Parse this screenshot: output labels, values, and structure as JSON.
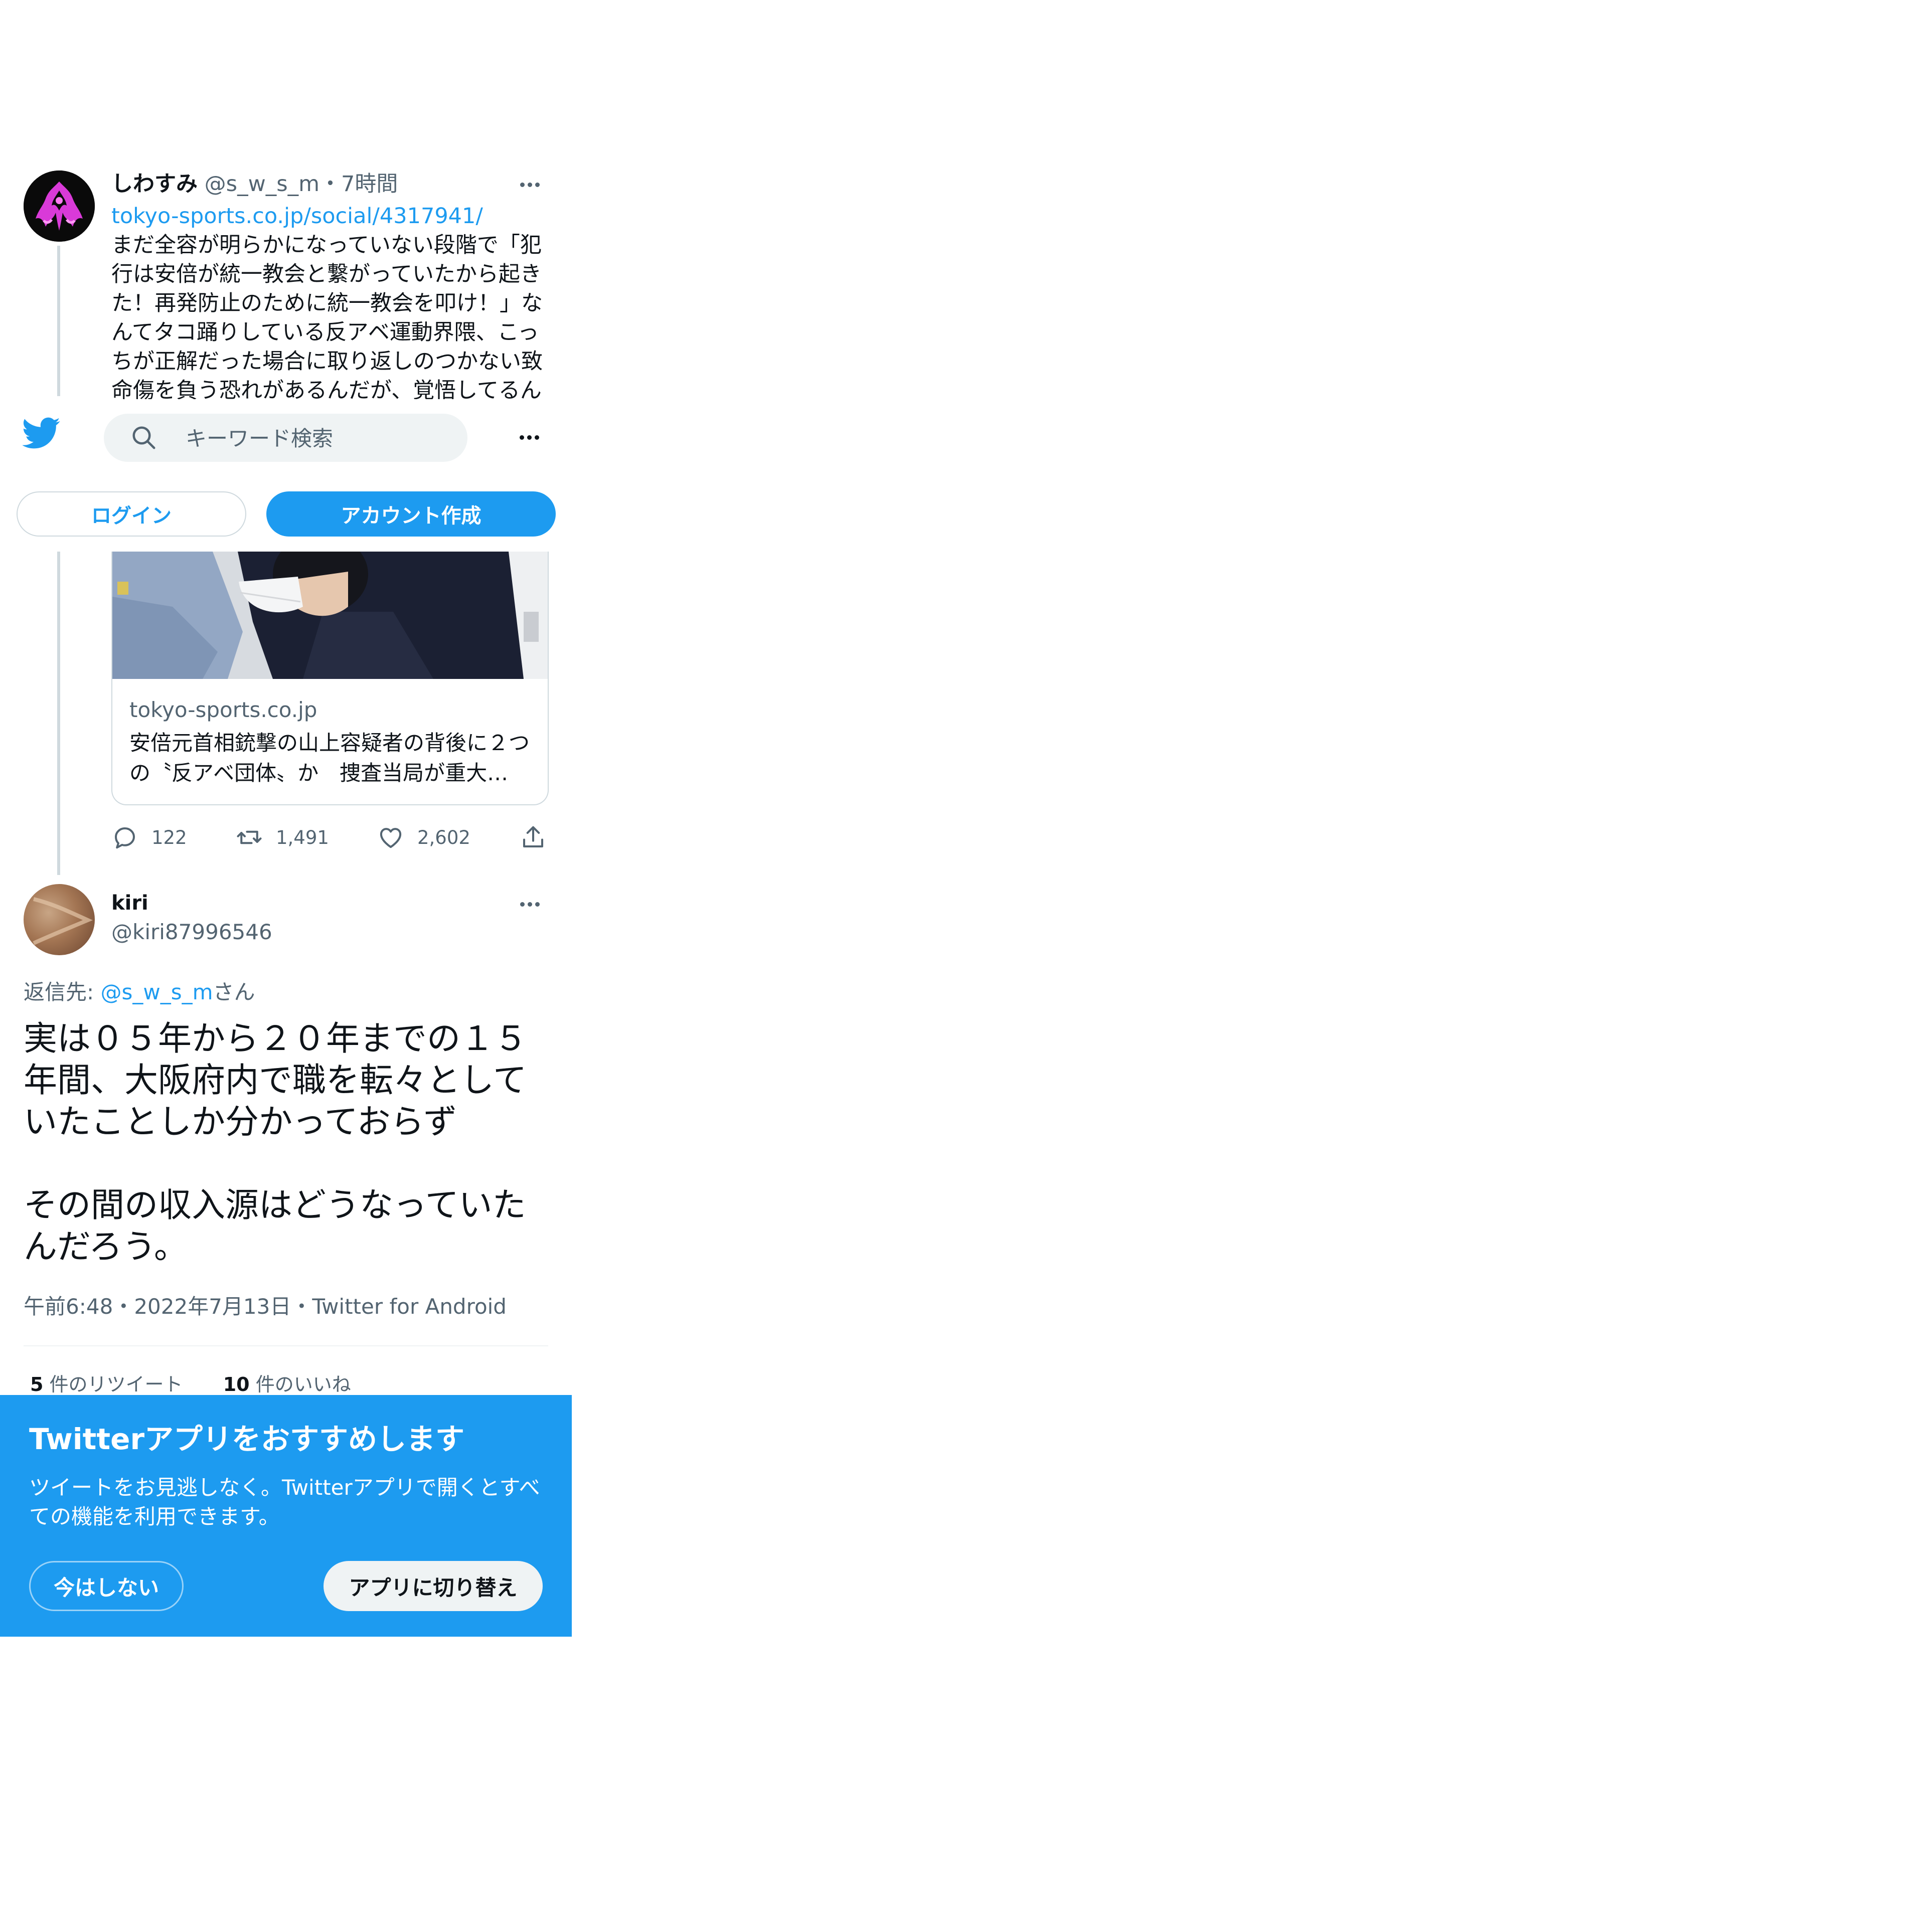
{
  "parent_tweet": {
    "name": "しわすみ",
    "handle": "@s_w_s_m",
    "time": "・7時間",
    "link": "tokyo-sports.co.jp/social/4317941/",
    "body": "まだ全容が明らかになっていない段階で「犯行は安倍が統一教会と繋がっていたから起きた！再発防止のために統一教会を叩け！」なんてタコ踊りしている反アベ運動界隈、こっちが正解だった場合に取り返しのつかない致命傷を負う恐れがあるんだが、覚悟してるん",
    "card": {
      "domain": "tokyo-sports.co.jp",
      "title": "安倍元首相銃撃の山上容疑者の背後に２つの〝反アベ団体〟か　捜査当局が重大…"
    },
    "actions": {
      "replies": "122",
      "retweets": "1,491",
      "likes": "2,602"
    }
  },
  "nav": {
    "search_placeholder": "キーワード検索",
    "login_label": "ログイン",
    "signup_label": "アカウント作成"
  },
  "reply_tweet": {
    "name": "kiri",
    "handle": "@kiri87996546",
    "reply_to_prefix": "返信先: ",
    "reply_to_mention": "@s_w_s_m",
    "reply_to_suffix": "さん",
    "text": "実は０５年から２０年までの１５年間、大阪府内で職を転々としていたことしか分かっておらず\n\nその間の収入源はどうなっていたんだろう。",
    "meta": "午前6:48・2022年7月13日・Twitter for Android",
    "retweet_count": "5",
    "retweet_label": " 件のリツイート",
    "like_count": "10",
    "like_label": " 件のいいね"
  },
  "banner": {
    "title": "Twitterアプリをおすすめします",
    "description": "ツイートをお見逃しなく。Twitterアプリで開くとすべての機能を利用できます。",
    "not_now_label": "今はしない",
    "switch_label": "アプリに切り替え"
  },
  "colors": {
    "accent": "#1d9bf0",
    "text_primary": "#0f1419",
    "text_secondary": "#536471"
  }
}
